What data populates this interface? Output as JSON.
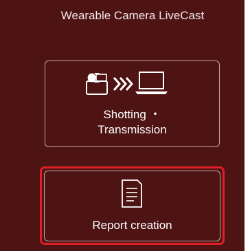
{
  "app": {
    "title": "Wearable Camera LiveCast"
  },
  "menu": {
    "shooting_button": {
      "label_line1": "Shotting ・",
      "label_line2": "Transmission",
      "icon": "camera-transmission-icon"
    },
    "report_button": {
      "label": "Report creation",
      "icon": "document-icon",
      "highlighted": true
    }
  },
  "colors": {
    "background": "#4e1313",
    "button_border": "#c9a7a7",
    "highlight": "#e01f26",
    "text": "#ffffff"
  }
}
